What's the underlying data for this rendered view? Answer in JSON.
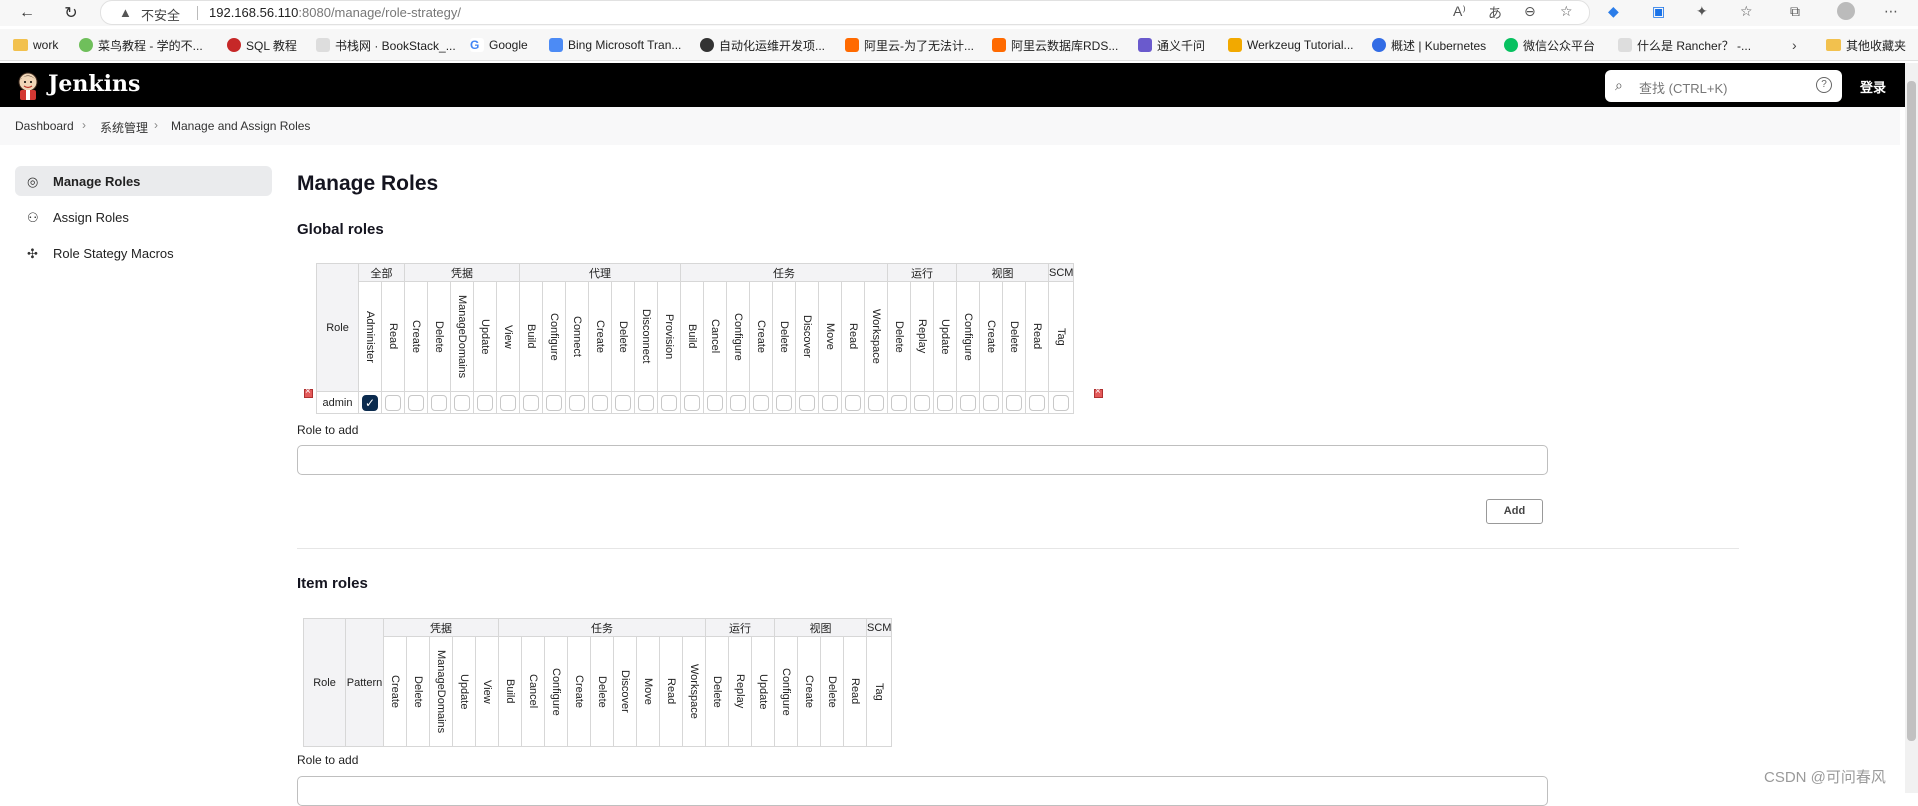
{
  "browser": {
    "not_secure": "不安全",
    "host": "192.168.56.110",
    "path": ":8080/manage/role-strategy/",
    "bookmarks": [
      "work",
      "菜鸟教程 - 学的不...",
      "SQL 教程",
      "书栈网 · BookStack_...",
      "Google",
      "Bing Microsoft Tran...",
      "自动化运维开发项...",
      "阿里云-为了无法计...",
      "阿里云数据库RDS...",
      "通义千问",
      "Werkzeug Tutorial...",
      "概述 | Kubernetes",
      "微信公众平台",
      "什么是 Rancher？ -...",
      "其他收藏夹"
    ]
  },
  "header": {
    "title": "Jenkins",
    "search_placeholder": "查找 (CTRL+K)",
    "help": "?",
    "login": "登录"
  },
  "breadcrumb": [
    "Dashboard",
    "系统管理",
    "Manage and Assign Roles"
  ],
  "sidebar": [
    {
      "label": "Manage Roles",
      "icon": "fingerprint-icon"
    },
    {
      "label": "Assign Roles",
      "icon": "users-icon"
    },
    {
      "label": "Role Stategy Macros",
      "icon": "puzzle-icon"
    }
  ],
  "main": {
    "title": "Manage Roles",
    "global_title": "Global roles",
    "item_title": "Item roles",
    "role_to_add": "Role to add",
    "add_button": "Add",
    "role_col": "Role",
    "pattern_col": "Pattern"
  },
  "global_groups": [
    {
      "name": "全部",
      "perms": [
        "Administer",
        "Read"
      ]
    },
    {
      "name": "凭据",
      "perms": [
        "Create",
        "Delete",
        "ManageDomains",
        "Update",
        "View"
      ]
    },
    {
      "name": "代理",
      "perms": [
        "Build",
        "Configure",
        "Connect",
        "Create",
        "Delete",
        "Disconnect",
        "Provision"
      ]
    },
    {
      "name": "任务",
      "perms": [
        "Build",
        "Cancel",
        "Configure",
        "Create",
        "Delete",
        "Discover",
        "Move",
        "Read",
        "Workspace"
      ]
    },
    {
      "name": "运行",
      "perms": [
        "Delete",
        "Replay",
        "Update"
      ]
    },
    {
      "name": "视图",
      "perms": [
        "Configure",
        "Create",
        "Delete",
        "Read"
      ]
    },
    {
      "name": "SCM",
      "perms": [
        "Tag"
      ]
    }
  ],
  "global_rows": [
    {
      "role": "admin",
      "checked": [
        "Administer"
      ]
    }
  ],
  "item_groups": [
    {
      "name": "凭据",
      "perms": [
        "Create",
        "Delete",
        "ManageDomains",
        "Update",
        "View"
      ]
    },
    {
      "name": "任务",
      "perms": [
        "Build",
        "Cancel",
        "Configure",
        "Create",
        "Delete",
        "Discover",
        "Move",
        "Read",
        "Workspace"
      ]
    },
    {
      "name": "运行",
      "perms": [
        "Delete",
        "Replay",
        "Update"
      ]
    },
    {
      "name": "视图",
      "perms": [
        "Configure",
        "Create",
        "Delete",
        "Read"
      ]
    },
    {
      "name": "SCM",
      "perms": [
        "Tag"
      ]
    }
  ],
  "watermark": "CSDN @可问春风"
}
